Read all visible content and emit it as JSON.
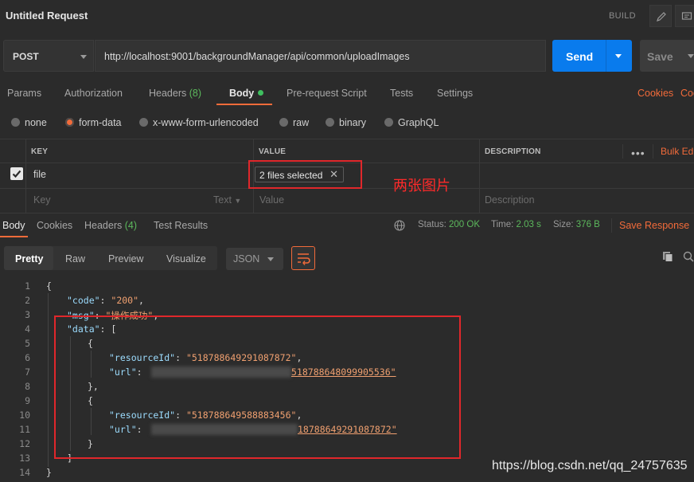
{
  "window": {
    "title": "Untitled Request",
    "build_label": "BUILD",
    "icons": [
      "pencil-icon",
      "comment-icon"
    ]
  },
  "request": {
    "method": "POST",
    "url": "http://localhost:9001/backgroundManager/api/common/uploadImages",
    "send_label": "Send",
    "save_label": "Save"
  },
  "tabs": {
    "items": [
      {
        "label": "Params"
      },
      {
        "label": "Authorization"
      },
      {
        "label": "Headers",
        "count": "(8)"
      },
      {
        "label": "Body"
      },
      {
        "label": "Pre-request Script"
      },
      {
        "label": "Tests"
      },
      {
        "label": "Settings"
      }
    ],
    "active": "Body",
    "cookies": "Cookies",
    "code": "Code",
    "accent_color": "#f26b3a"
  },
  "body_modes": {
    "options": [
      "none",
      "form-data",
      "x-www-form-urlencoded",
      "raw",
      "binary",
      "GraphQL"
    ],
    "selected": "form-data"
  },
  "form_table": {
    "headers": {
      "key": "KEY",
      "value": "VALUE",
      "description": "DESCRIPTION"
    },
    "bulk_edit": "Bulk Edit",
    "rows": [
      {
        "checked": true,
        "key": "file",
        "value": "2 files selected"
      }
    ],
    "new_row": {
      "key_placeholder": "Key",
      "type": "Text",
      "value_placeholder": "Value",
      "description_placeholder": "Description"
    }
  },
  "annotation": "两张图片",
  "response": {
    "tabs": [
      {
        "label": "Body"
      },
      {
        "label": "Cookies"
      },
      {
        "label": "Headers",
        "count": "(4)"
      },
      {
        "label": "Test Results"
      }
    ],
    "status_label": "Status:",
    "status": "200 OK",
    "time_label": "Time:",
    "time": "2.03 s",
    "size_label": "Size:",
    "size": "376 B",
    "save_response": "Save Response",
    "formats": [
      "Pretty",
      "Raw",
      "Preview",
      "Visualize"
    ],
    "format_active": "Pretty",
    "language": "JSON"
  },
  "code_lines": {
    "numbers": [
      "1",
      "2",
      "3",
      "4",
      "5",
      "6",
      "7",
      "8",
      "9",
      "10",
      "11",
      "12",
      "13",
      "14"
    ],
    "l1": "{",
    "l2_key": "\"code\"",
    "l2_val": "\"200\"",
    "l3_key": "\"msg\"",
    "l3_val": "\"操作成功\"",
    "l4_key": "\"data\"",
    "l4_open": "[",
    "l5": "{",
    "l6_key": "\"resourceId\"",
    "l6_val": "\"518788649291087872\"",
    "l7_key": "\"url\"",
    "l7_val": "518788648099905536\"",
    "l8": "},",
    "l9": "{",
    "l10_key": "\"resourceId\"",
    "l10_val": "\"518788649588883456\"",
    "l11_key": "\"url\"",
    "l11_val": "18788649291087872\"",
    "l12": "}",
    "l13": "]",
    "l14": "}"
  },
  "watermark": "https://blog.csdn.net/qq_24757635"
}
